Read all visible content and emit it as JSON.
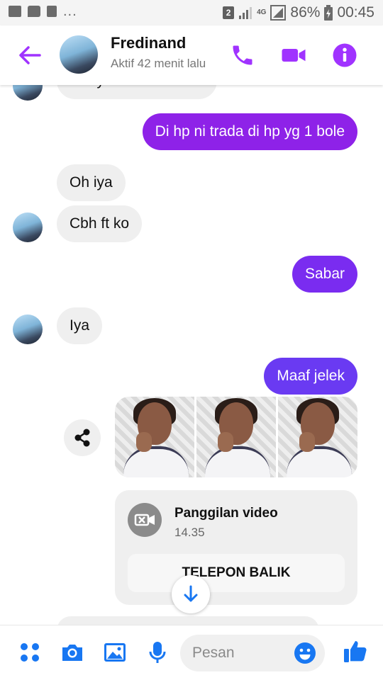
{
  "status_bar": {
    "sim_badge": "2",
    "network_type": "4G",
    "battery": "86%",
    "time": "00:45",
    "overflow": "..."
  },
  "header": {
    "contact_name": "Fredinand",
    "presence": "Aktif 42 menit lalu",
    "icons": [
      "back-arrow-icon",
      "phone-icon",
      "video-camera-icon",
      "info-icon"
    ],
    "accent_color": "#a033ff"
  },
  "messages": [
    {
      "direction": "in",
      "text": "Oh iya  kmu kirim ft k",
      "partial": true
    },
    {
      "direction": "out",
      "text": "Di hp ni trada di hp yg 1 bole"
    },
    {
      "direction": "in",
      "text": "Oh iya"
    },
    {
      "direction": "in",
      "text": "Cbh ft ko"
    },
    {
      "direction": "out",
      "text": "Sabar"
    },
    {
      "direction": "in",
      "text": "Iya"
    },
    {
      "direction": "out",
      "text": "Maaf jelek"
    }
  ],
  "photos": {
    "count": 3
  },
  "call_card": {
    "title": "Panggilan video",
    "time": "14.35",
    "action": "TELEPON BALIK"
  },
  "composer": {
    "placeholder": "Pesan",
    "icons": [
      "menu-dots-icon",
      "camera-icon",
      "gallery-icon",
      "microphone-icon",
      "emoji-icon",
      "thumbs-up-icon"
    ],
    "accent_color": "#1877f2"
  },
  "colors": {
    "outgoing_bubble": "#8e22e8",
    "incoming_bubble": "#efefef"
  }
}
